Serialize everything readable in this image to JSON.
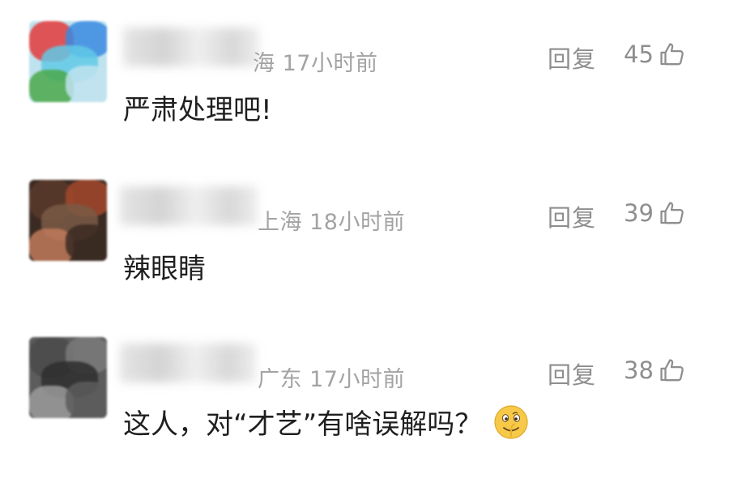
{
  "comments": [
    {
      "location_time": "海 17小时前",
      "reply_label": "回复",
      "likes": "45",
      "text": "严肃处理吧!",
      "avatar_colors": [
        "#e33b3b",
        "#3a8be0",
        "#61c9e6",
        "#4aa84a",
        "#bfe3ee"
      ]
    },
    {
      "location_time": "上海 18小时前",
      "reply_label": "回复",
      "likes": "39",
      "text": "辣眼睛",
      "avatar_colors": [
        "#5a3a2a",
        "#a3482c",
        "#7a5a45",
        "#c07a5a",
        "#3a2a22"
      ]
    },
    {
      "location_time": "广东 17小时前",
      "reply_label": "回复",
      "likes": "38",
      "text": "这人，对“才艺”有啥误解吗？",
      "emoji": "thinking-grin-emoji",
      "avatar_colors": [
        "#4a4a4a",
        "#7a7a7a",
        "#2e2e2e",
        "#9a9a9a",
        "#5c5c5c"
      ]
    }
  ],
  "icons": {
    "like": "thumbs-up-icon"
  },
  "colors": {
    "meta": "#a3a3a3",
    "action": "#8e8e8e",
    "text": "#1f1f1f"
  }
}
